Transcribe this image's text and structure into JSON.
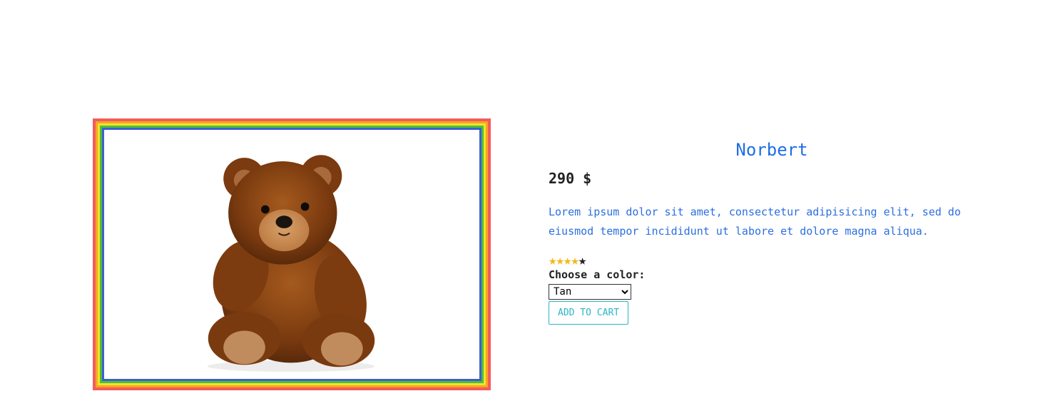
{
  "product": {
    "name": "Norbert",
    "price": "290 $",
    "description": "Lorem ipsum dolor sit amet, consectetur adipisicing elit, sed do eiusmod tempor incididunt ut labore et dolore magna aliqua.",
    "rating": 4,
    "rating_max": 5,
    "color_label": "Choose a color:",
    "selected_color": "Tan",
    "add_to_cart_label": "ADD TO CART",
    "image_subject": "teddy-bear"
  },
  "colors": {
    "title": "#1f6fe5",
    "star_filled": "#f3b81b",
    "button_accent": "#2bb5c6",
    "frame_outer": "#f25c5c"
  }
}
